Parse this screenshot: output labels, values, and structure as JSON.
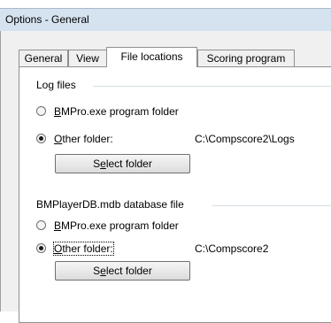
{
  "window": {
    "title": "Options - General"
  },
  "tabs": [
    {
      "label": "General",
      "active": false
    },
    {
      "label": "View",
      "active": false
    },
    {
      "label": "File locations",
      "active": true
    },
    {
      "label": "Scoring program",
      "active": false
    }
  ],
  "log_files": {
    "header": "Log files",
    "option_program": {
      "label_u": "B",
      "label_rest": "MPro.exe program folder",
      "selected": false
    },
    "option_other": {
      "label_u": "O",
      "label_rest": "ther folder:",
      "selected": true
    },
    "path": "C:\\Compscore2\\Logs",
    "button": {
      "pre": "S",
      "u": "e",
      "post": "lect folder"
    }
  },
  "database_file": {
    "header": "BMPlayerDB.mdb database file",
    "option_program": {
      "label_u": "B",
      "label_rest": "MPro.exe program folder",
      "selected": false
    },
    "option_other": {
      "label_u": "O",
      "label_rest": "ther folder:",
      "selected": true,
      "focused": true
    },
    "path": "C:\\Compscore2",
    "button": {
      "pre": "S",
      "u": "e",
      "post": "lect folder"
    }
  }
}
